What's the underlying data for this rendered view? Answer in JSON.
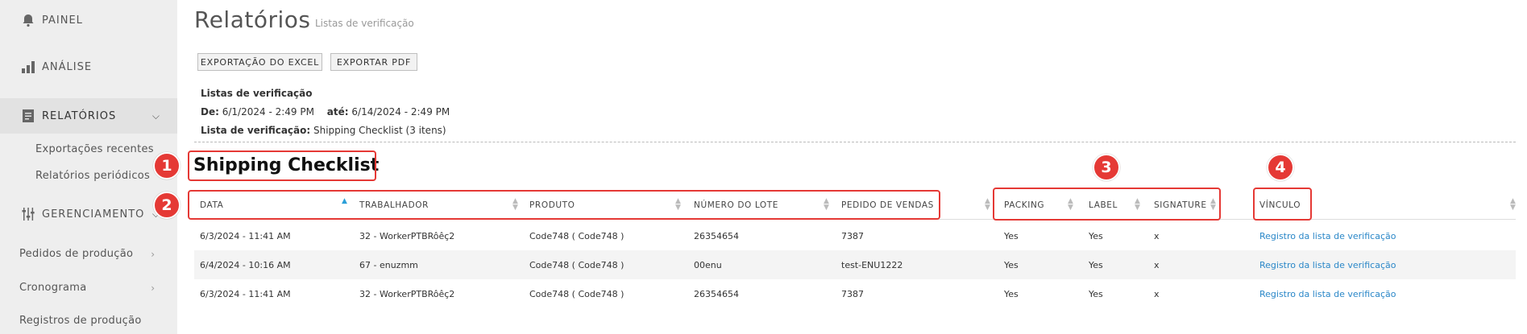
{
  "sidebar": {
    "items": [
      {
        "label": "PAINEL",
        "icon": "bell-icon"
      },
      {
        "label": "ANÁLISE",
        "icon": "bar-chart-icon"
      },
      {
        "label": "RELATÓRIOS",
        "icon": "document-icon"
      },
      {
        "label": "GERENCIAMENTO",
        "icon": "sliders-icon"
      }
    ],
    "sub_items": [
      "Exportações recentes",
      "Relatórios periódicos"
    ],
    "plain_items": [
      "Pedidos de produção",
      "Cronograma",
      "Registros de produção"
    ]
  },
  "header": {
    "title": "Relatórios",
    "subtitle": "Listas de verificação"
  },
  "toolbar": {
    "excel_label": "EXPORTAÇÃO DO EXCEL",
    "pdf_label": "EXPORTAR PDF"
  },
  "report_meta": {
    "heading": "Listas de verificação",
    "from_label": "De:",
    "from_value": "6/1/2024 - 2:49 PM",
    "to_label": "até:",
    "to_value": "6/14/2024 - 2:49 PM",
    "checklist_label": "Lista de verificação:",
    "checklist_value": "Shipping Checklist (3 itens)"
  },
  "section_title": "Shipping Checklist",
  "table": {
    "columns": [
      "DATA",
      "TRABALHADOR",
      "PRODUTO",
      "NÚMERO DO LOTE",
      "PEDIDO DE VENDAS",
      "PACKING",
      "LABEL",
      "SIGNATURE",
      "VÍNCULO"
    ],
    "sorted_column": "DATA",
    "rows": [
      [
        "6/3/2024 - 11:41 AM",
        "32 - WorkerPTBRôêç2",
        "Code748 ( Code748 )",
        "26354654",
        "7387",
        "Yes",
        "Yes",
        "x",
        "Registro da lista de verificação"
      ],
      [
        "6/4/2024 - 10:16 AM",
        "67 - enuzmm",
        "Code748 ( Code748 )",
        "00enu",
        "test-ENU1222",
        "Yes",
        "Yes",
        "x",
        "Registro da lista de verificação"
      ],
      [
        "6/3/2024 - 11:41 AM",
        "32 - WorkerPTBRôêç2",
        "Code748 ( Code748 )",
        "26354654",
        "7387",
        "Yes",
        "Yes",
        "x",
        "Registro da lista de verificação"
      ]
    ]
  },
  "annotations": [
    "1",
    "2",
    "3",
    "4"
  ],
  "colors": {
    "annotation": "#e53935",
    "link": "#2a87c8",
    "sort_active": "#2b9fd8",
    "sidebar_bg": "#eeeeee"
  }
}
